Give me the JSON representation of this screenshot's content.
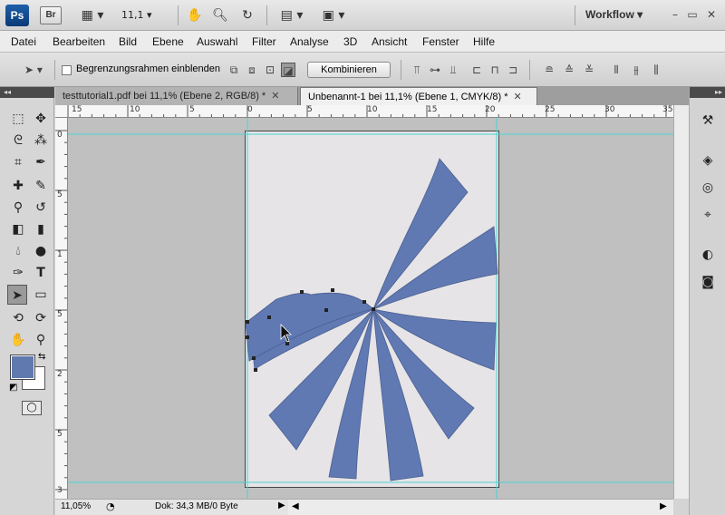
{
  "titlebar": {
    "ps_logo": "Ps",
    "br_logo": "Br",
    "zoom": "11,1",
    "workspace": "Workflow"
  },
  "menu": [
    "Datei",
    "Bearbeiten",
    "Bild",
    "Ebene",
    "Auswahl",
    "Filter",
    "Analyse",
    "3D",
    "Ansicht",
    "Fenster",
    "Hilfe"
  ],
  "options": {
    "bounding_label": "Begrenzungsrahmen einblenden",
    "combine_label": "Kombinieren"
  },
  "tabs": [
    {
      "label": "testtutorial1.pdf bei 11,1% (Ebene 2, RGB/8) *"
    },
    {
      "label": "Unbenannt-1 bei 11,1% (Ebene 1, CMYK/8) *"
    }
  ],
  "ruler_top": [
    "15",
    "10",
    "5",
    "0",
    "5",
    "10",
    "15",
    "20",
    "25",
    "30",
    "35"
  ],
  "ruler_left": [
    "0",
    "5",
    "1",
    "5",
    "2",
    "5",
    "3"
  ],
  "status": {
    "zoom": "11,05%",
    "doc": "Dok: 34,3 MB/0 Byte"
  },
  "colors": {
    "foreground": "#607aaf",
    "background": "#ffffff",
    "shape_fill": "#6079b3",
    "guide": "#4ad4d4"
  }
}
